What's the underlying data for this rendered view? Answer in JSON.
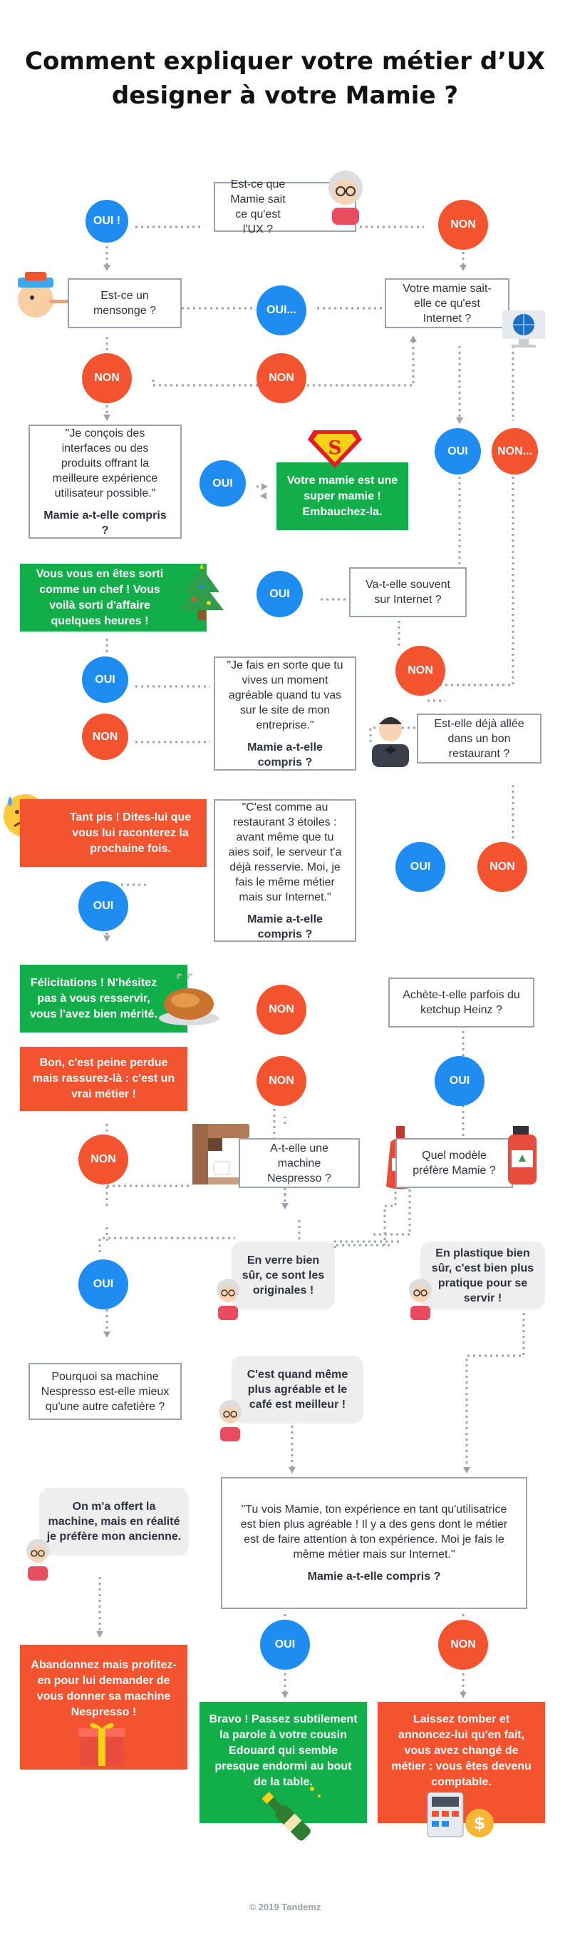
{
  "title": "Comment expliquer votre métier d’UX designer à votre Mamie ?",
  "footer": "© 2019 Tandemz",
  "labels": {
    "oui": "OUI",
    "oui_ex": "OUI !",
    "non": "NON",
    "oui_dots": "OUI...",
    "non_dots": "NON..."
  },
  "boxes": {
    "start": "Est-ce que Mamie sait ce qu'est l'UX ?",
    "lie": "Est-ce un mensonge ?",
    "internet": "Votre mamie sait-elle ce qu'est Internet ?",
    "designs": "\"Je conçois des interfaces ou des produits offrant la meilleure expérience utilisateur possible.\"",
    "understood": "Mamie a-t-elle compris ?",
    "often_internet": "Va-t-elle souvent sur Internet ?",
    "moment": "\"Je fais en sorte que tu vives un moment agréable quand tu vas sur le site de mon entreprise.\"",
    "restaurant": "Est-elle déjà allée dans un bon restaurant ?",
    "three_stars": "\"C'est comme au restaurant 3 étoiles : avant même que tu aies soif, le serveur t'a déjà resservie. Moi, je fais le même métier mais sur Internet.\"",
    "ketchup": "Achète-t-elle parfois du ketchup Heinz ?",
    "nespresso": "A-t-elle une machine Nespresso ?",
    "which_model": "Quel modèle préfère Mamie ?",
    "why_nespresso": "Pourquoi sa machine Nespresso est-elle mieux qu'une autre cafetière ?",
    "final": "\"Tu vois Mamie,  ton expérience en tant qu'utilisatrice est bien plus agréable ! Il y a des gens dont le métier est de faire attention à ton expérience. Moi je fais le même métier mais sur Internet.\""
  },
  "banners": {
    "super": "Votre mamie est une super mamie ! Embauchez-la.",
    "chef": "Vous vous en êtes sorti comme un chef ! Vous voilà sorti d'affaire quelques heures !",
    "too_bad": "Tant pis ! Dites-lui que vous lui raconterez la prochaine fois.",
    "congrats": "Félicitations ! N'hésitez pas à vous resservir, vous l'avez bien mérité.",
    "lost": "Bon, c'est peine perdue mais rassurez-là : c'est un vrai métier !",
    "gift": "Abandonnez mais profitez-en pour lui demander de vous donner sa machine Nespresso !",
    "bravo": "Bravo !  Passez subtilement la parole à votre cousin Edouard qui semble presque endormi au bout de la table.",
    "give_up": "Laissez tomber et annoncez-lui qu'en fait, vous avez changé de métier : vous êtes devenu comptable."
  },
  "bubbles": {
    "glass": "En verre bien sûr, ce sont les originales !",
    "plastic": "En plastique bien sûr, c'est bien plus pratique pour se servir !",
    "nicer": "C'est quand même plus agréable et le café est meilleur !",
    "gift_machine": "On m'a offert la machine, mais en réalité je préfère mon ancienne."
  },
  "icons": {
    "grandma": "grandma-icon",
    "pinocchio": "pinocchio-icon",
    "globe": "internet-globe-icon",
    "superman": "superman-logo-icon",
    "tree": "christmas-tree-icon",
    "waiter": "waiter-icon",
    "sad": "sad-face-icon",
    "turkey": "roast-turkey-icon",
    "coffee": "coffee-machine-icon",
    "ketchup": "ketchup-bottles-icon",
    "gift": "gift-icon",
    "champagne": "champagne-icon",
    "calculator": "calculator-icon"
  },
  "colors": {
    "blue": "#1e8cf0",
    "red": "#f4532f",
    "green": "#12ae4a",
    "line": "#9aa3ad",
    "bubble": "#eeeeee"
  }
}
